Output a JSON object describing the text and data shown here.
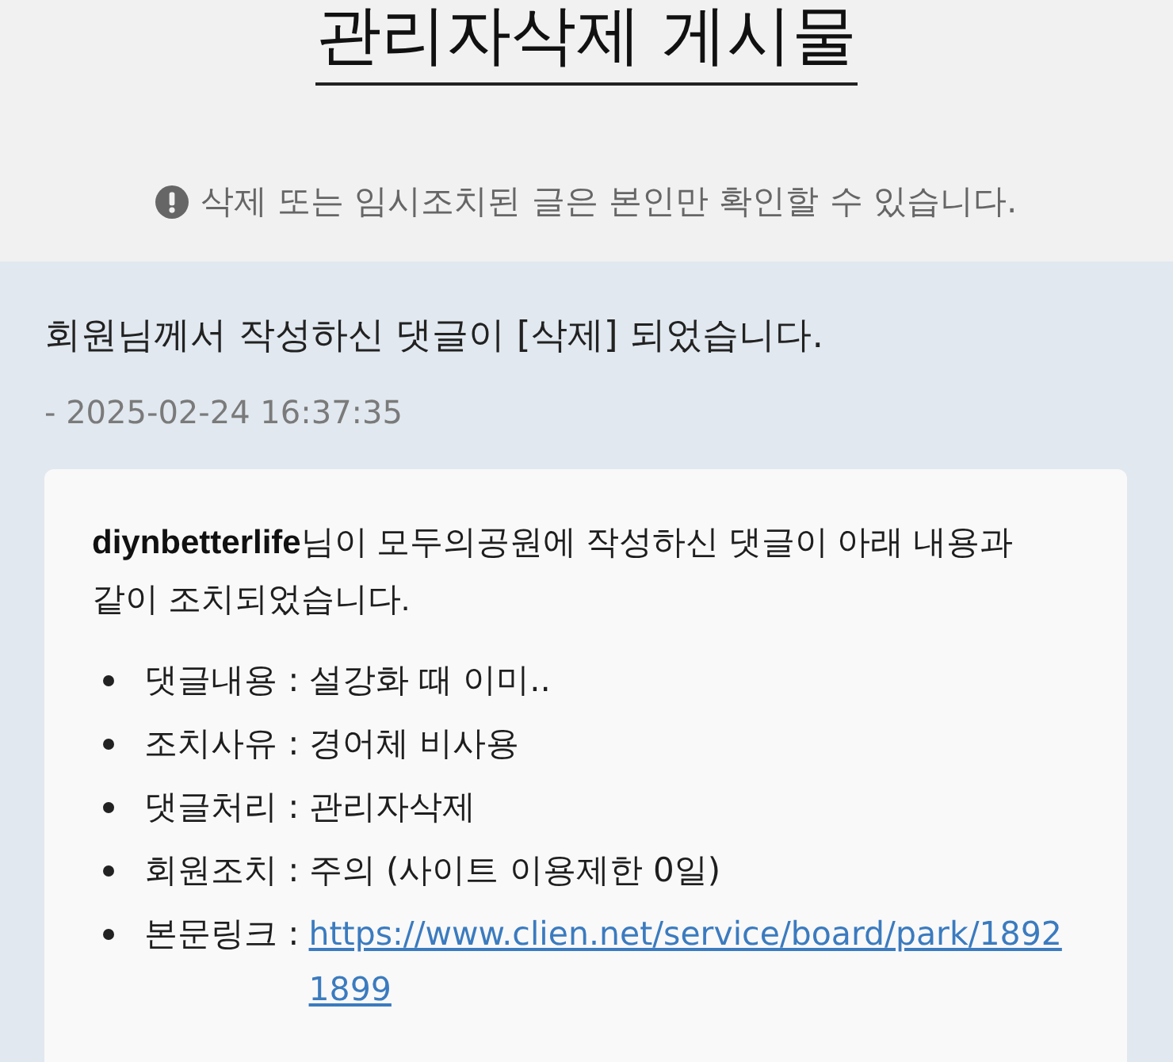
{
  "header": {
    "title": "관리자삭제 게시물",
    "notice": "삭제 또는 임시조치된 글은 본인만 확인할 수 있습니다."
  },
  "message": {
    "text": "회원님께서 작성하신 댓글이 [삭제] 되었습니다.",
    "date": "- 2025-02-24 16:37:35"
  },
  "card": {
    "intro": "**diynbetterlife**님이 모두의공원에 작성하신 댓글이 아래 내용과 같이 조치되었습니다.",
    "items": [
      {
        "kind": "text",
        "label": "댓글내용 :",
        "value": "설강화 때 이미.."
      },
      {
        "kind": "text",
        "label": "조치사유 :",
        "value": "경어체 비사용"
      },
      {
        "kind": "text",
        "label": "댓글처리 :",
        "value": "관리자삭제"
      },
      {
        "kind": "text",
        "label": "회원조치 :",
        "value": "주의 (사이트 이용제한 0일)"
      },
      {
        "kind": "link",
        "label": "본문링크 :",
        "value": "https://www.clien.net/service/board/park/18921899"
      }
    ]
  }
}
